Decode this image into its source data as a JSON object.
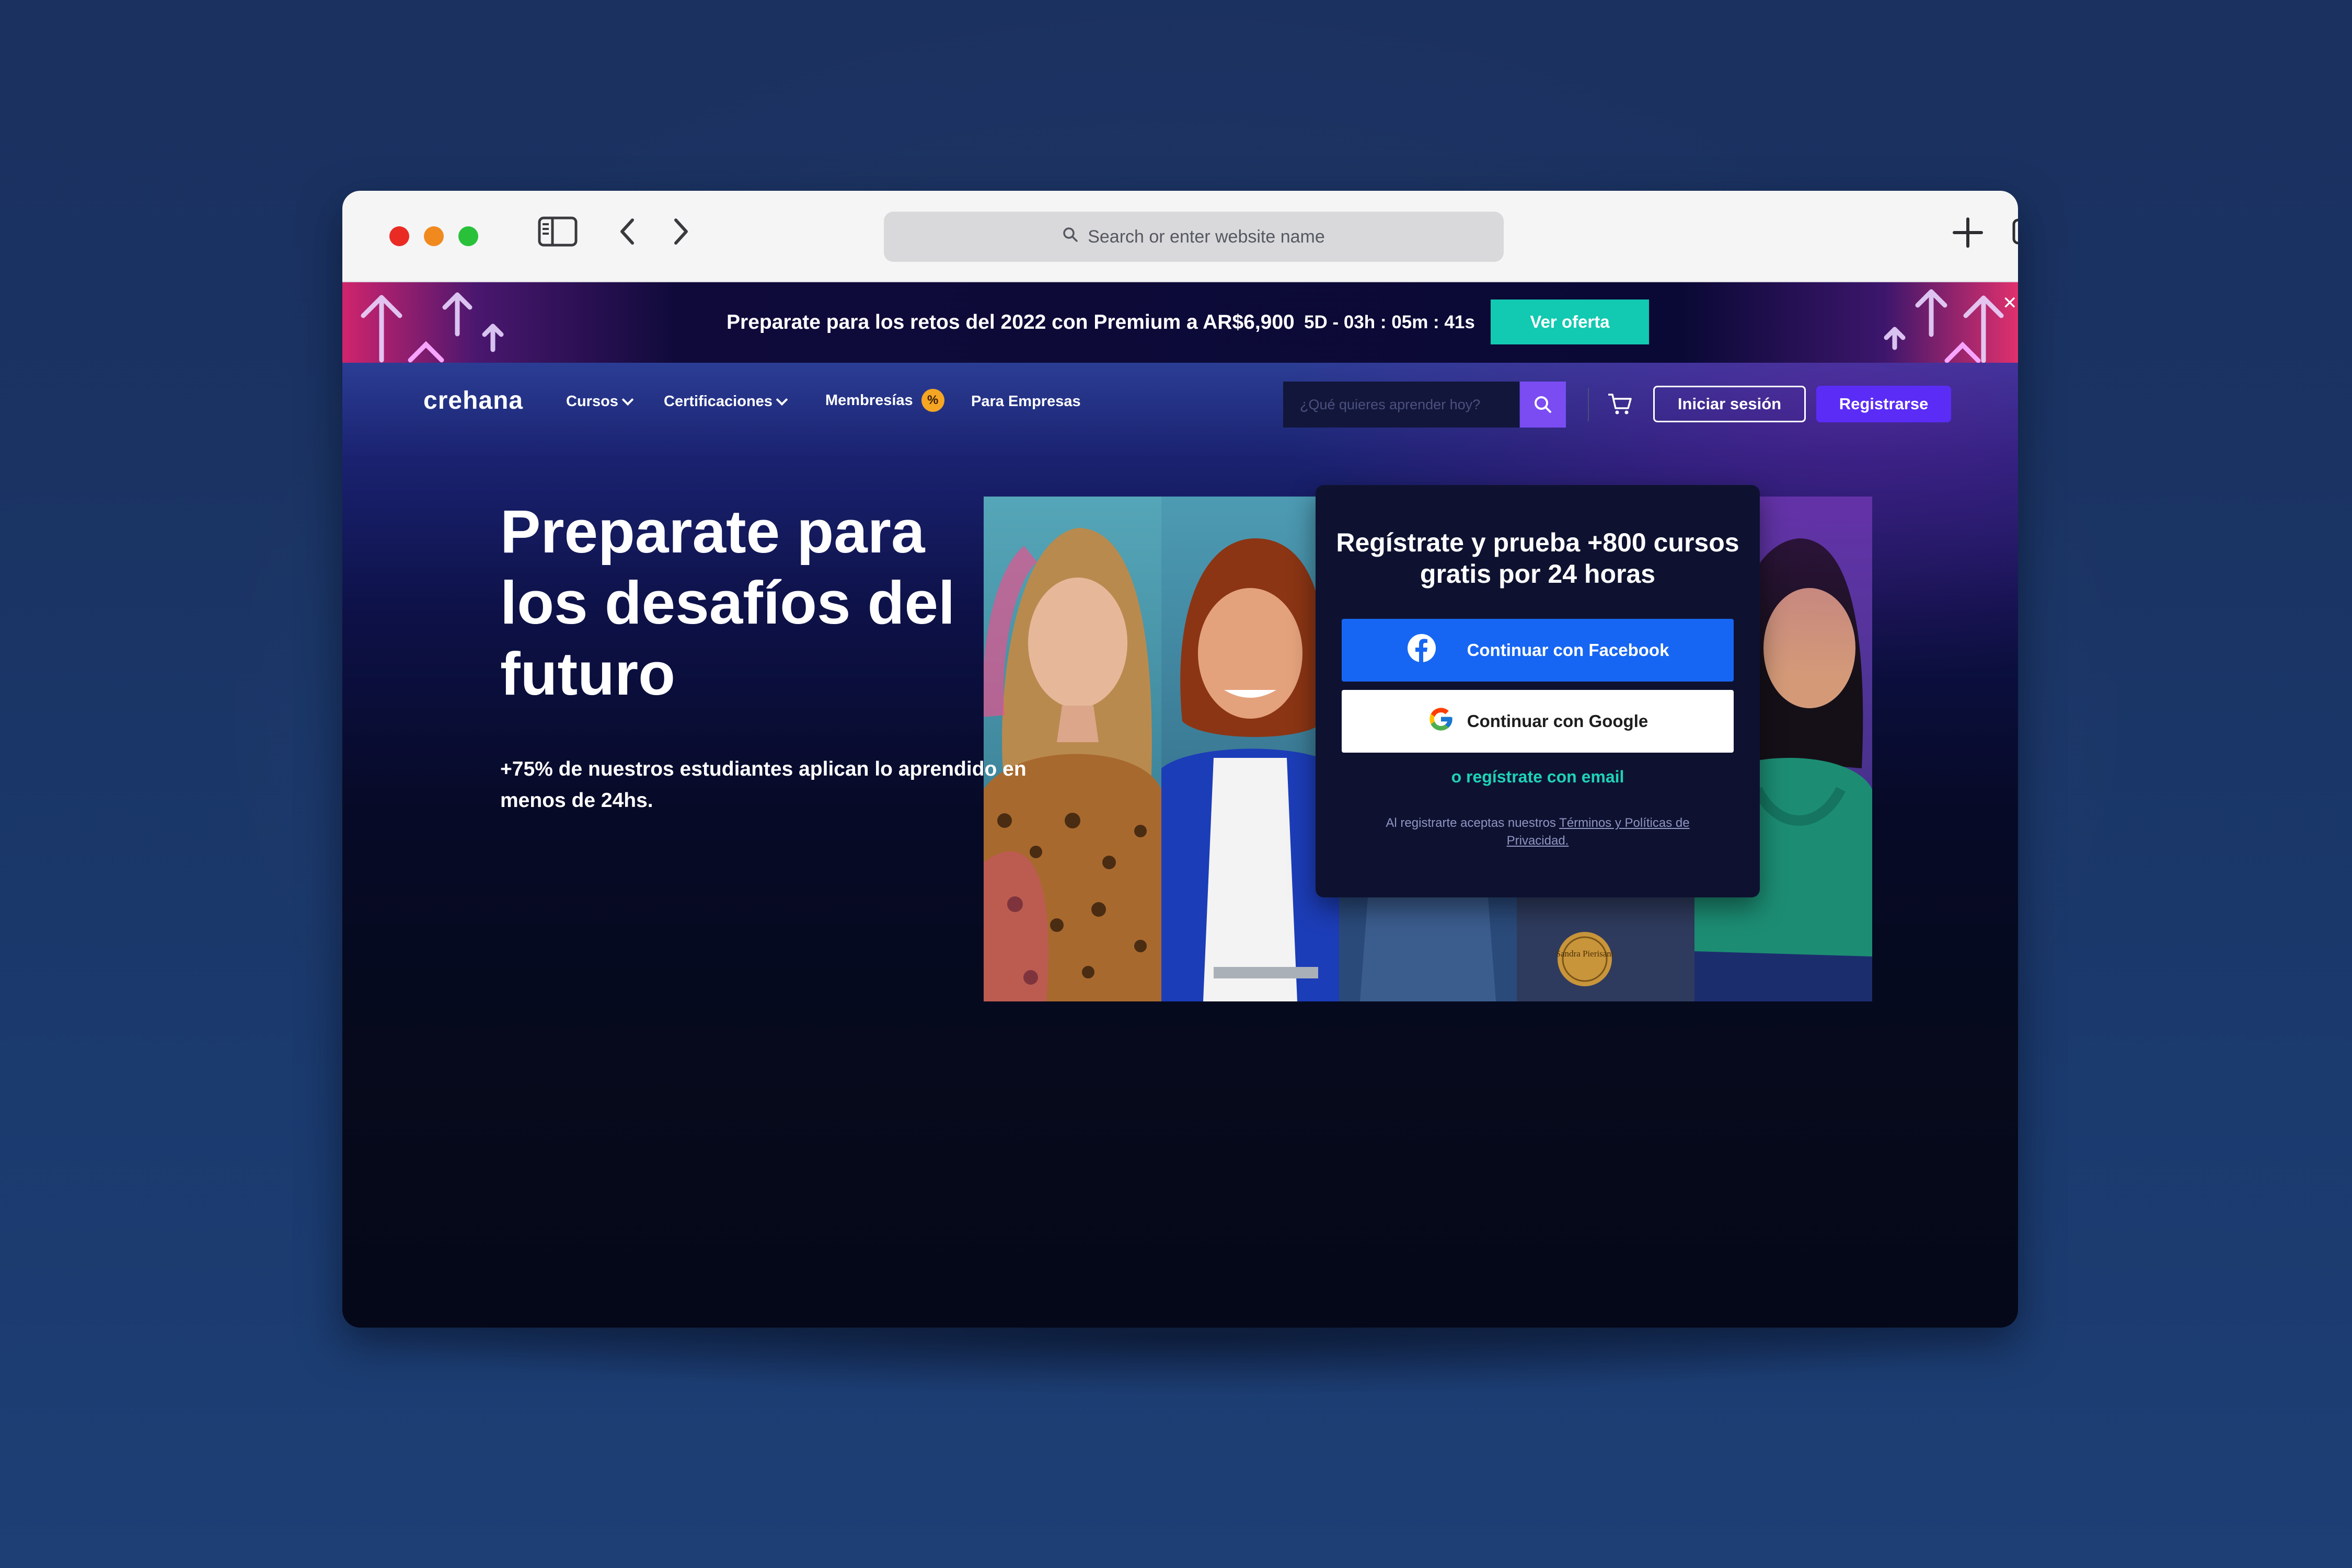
{
  "browser": {
    "address_placeholder": "Search or enter website name",
    "icons": [
      "sidebar-icon",
      "back-icon",
      "forward-icon",
      "search-icon",
      "new-tab-icon",
      "tabs-overview-icon"
    ]
  },
  "promo": {
    "text": "Preparate para los retos del 2022 con Premium a AR$6,900",
    "countdown": "5D - 03h : 05m : 41s",
    "cta": "Ver oferta"
  },
  "nav": {
    "logo": "crehana",
    "items": [
      {
        "label": "Cursos"
      },
      {
        "label": "Certificaciones"
      },
      {
        "label": "Membresías",
        "badge": "%"
      },
      {
        "label": "Para Empresas"
      }
    ],
    "search_placeholder": "¿Qué quieres aprender hoy?",
    "login": "Iniciar sesión",
    "signup": "Registrarse"
  },
  "hero": {
    "title": "Preparate para los desafíos del futuro",
    "subtitle": "+75% de nuestros estudiantes aplican lo aprendido en menos de 24hs."
  },
  "signup_card": {
    "title": "Regístrate y prueba +800 cursos gratis por 24 horas",
    "facebook": "Continuar con Facebook",
    "google": "Continuar con Google",
    "email": "o regístrate con email",
    "legal_prefix": "Al registrarte aceptas nuestros",
    "legal_link": "Términos y Políticas de Privacidad."
  },
  "photo_badge": "Sandra Pierisani",
  "colors": {
    "accent_teal": "#12c9b1",
    "accent_purple": "#5b2cf6",
    "facebook_blue": "#1766f3",
    "page_bg": "#1b3160"
  }
}
